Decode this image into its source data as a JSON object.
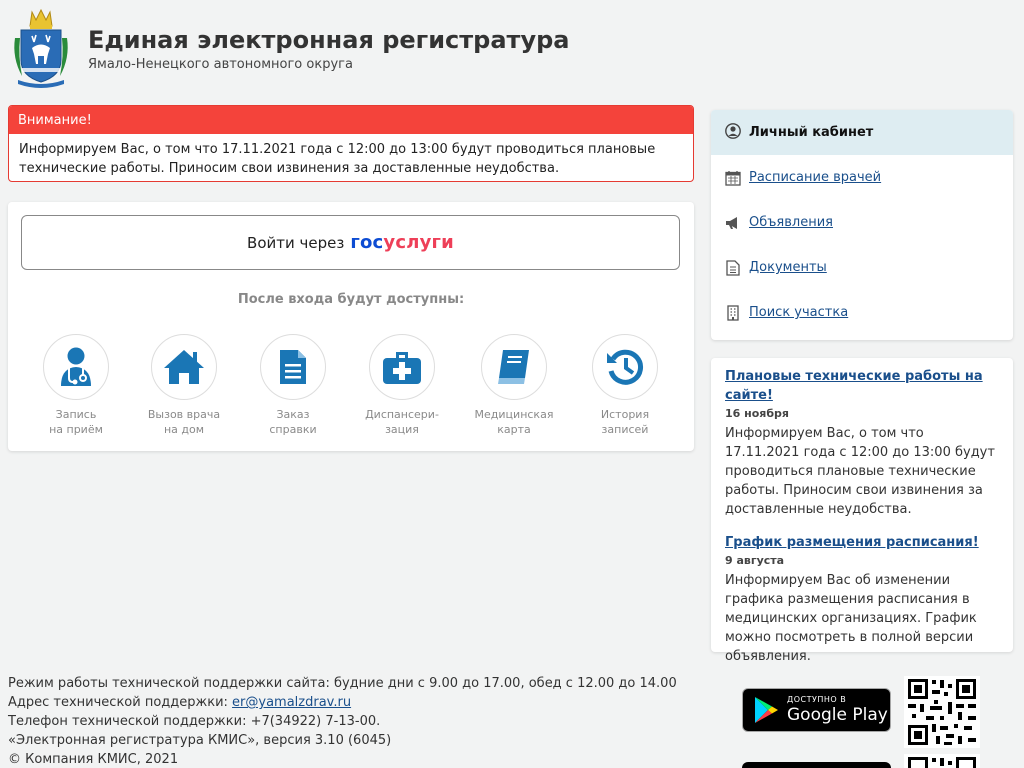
{
  "header": {
    "title": "Единая электронная регистратура",
    "subtitle": "Ямало-Ненецкого автономного округа"
  },
  "alert": {
    "heading": "Внимание!",
    "text": "Информируем Вас, о том что 17.11.2021 года с 12:00 до 13:00 будут проводиться плановые технические работы. Приносим свои извинения за доставленные неудобства."
  },
  "login": {
    "button_prefix": "Войти через",
    "gos_part1": "гос",
    "gos_part2": "услуги",
    "available_label": "После входа будут доступны:",
    "features": [
      {
        "label": "Запись\nна приём",
        "icon": "doctor-icon"
      },
      {
        "label": "Вызов врача\nна дом",
        "icon": "house-icon"
      },
      {
        "label": "Заказ\nсправки",
        "icon": "document-icon"
      },
      {
        "label": "Диспансери-\nзация",
        "icon": "medkit-icon"
      },
      {
        "label": "Медицинская\nкарта",
        "icon": "book-icon"
      },
      {
        "label": "История\nзаписей",
        "icon": "history-icon"
      }
    ]
  },
  "cabinet": {
    "heading": "Личный кабинет",
    "items": [
      {
        "label": "Расписание врачей",
        "icon": "calendar-icon"
      },
      {
        "label": "Объявления",
        "icon": "megaphone-icon"
      },
      {
        "label": "Документы",
        "icon": "document-icon"
      },
      {
        "label": "Поиск участка",
        "icon": "building-icon"
      }
    ]
  },
  "news": [
    {
      "title": "Плановые технические работы на сайте!",
      "date": "16 ноября",
      "text": "Информируем Вас, о том что 17.11.2021 года с 12:00 до 13:00 будут проводиться плановые технические работы. Приносим свои извинения за доставленные неудобства."
    },
    {
      "title": "График размещения расписания!",
      "date": "9 августа",
      "text": "Информируем Вас об изменении графика размещения расписания в медицинских организациях. График можно посмотреть в полной версии объявления."
    }
  ],
  "footer": {
    "line1": "Режим работы технической поддержки сайта: будние дни с 9.00 до 17.00, обед с 12.00 до 14.00",
    "line2_prefix": "Адрес технической поддержки: ",
    "email": "er@yamalzdrav.ru",
    "line3": "Телефон технической поддержки: +7(34922) 7-13-00.",
    "line4": "«Электронная регистратура КМИС», версия 3.10 (6045)",
    "line5": "© Компания КМИС, 2021"
  },
  "apps": {
    "gplay_small": "ДОСТУПНО В",
    "gplay_big": "Google Play"
  },
  "colors": {
    "accent": "#1a76b5",
    "alert": "#f4433b",
    "link": "#1a4f8b",
    "gos_blue": "#0d4cd3",
    "gos_red": "#ee3f58"
  }
}
